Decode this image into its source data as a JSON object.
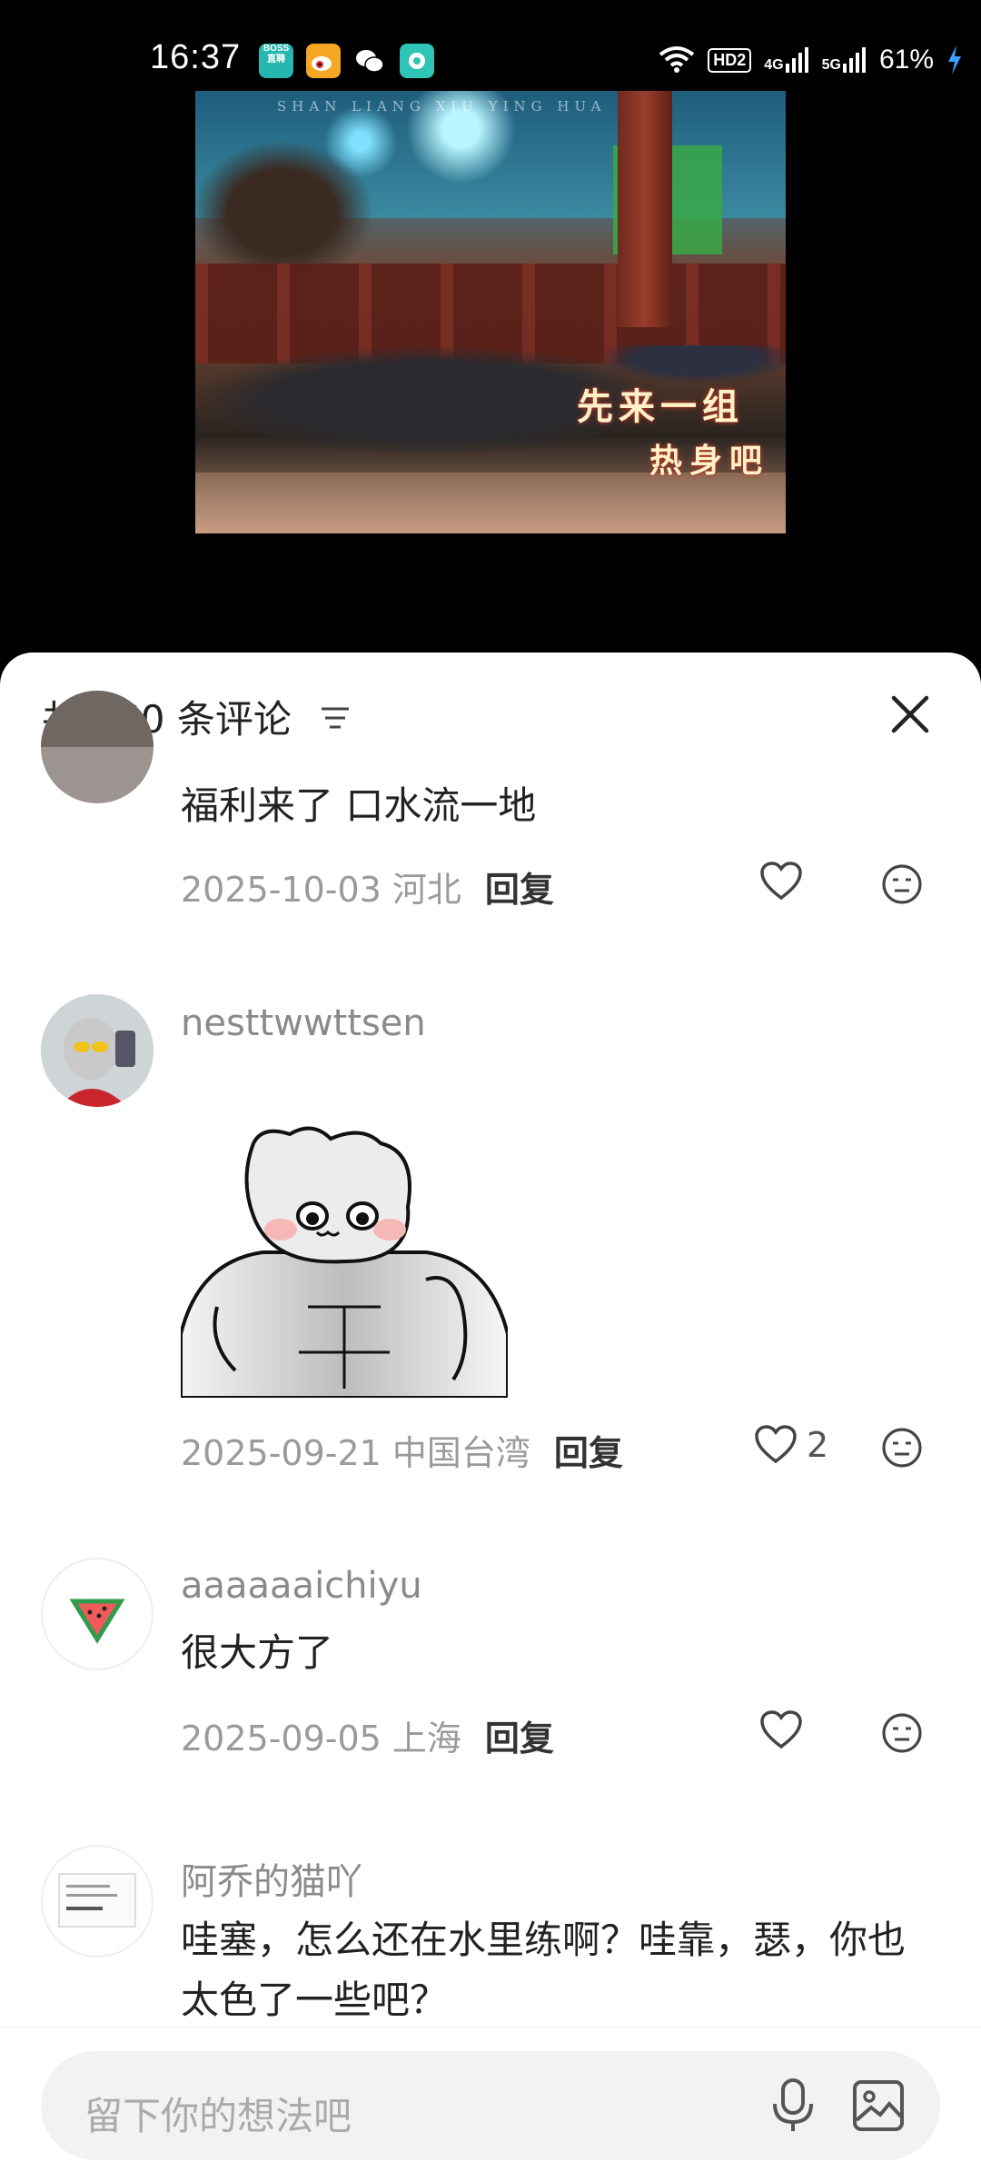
{
  "status": {
    "time": "16:37",
    "app_icons": [
      {
        "name": "boss-zhipin-icon",
        "label": "BOSS 直聘",
        "color": "#25b7b0"
      },
      {
        "name": "weibo-icon",
        "label": "",
        "color": "#f5a623"
      },
      {
        "name": "wechat-icon",
        "label": "",
        "color": "#ffffff"
      },
      {
        "name": "chat-bubble-app-icon",
        "label": "",
        "color": "#2ec4b6"
      }
    ],
    "hd": "HD2",
    "net1": "4G",
    "net2": "5G",
    "battery": "61%"
  },
  "video": {
    "watermark": "SHAN LIANG XIU YING HUA",
    "caption_line1": "先来一组",
    "caption_line2": "热身吧"
  },
  "sheet": {
    "title": "共 160 条评论"
  },
  "comments": [
    {
      "username": "",
      "text": "福利来了 口水流一地",
      "date_location": "2025-10-03 河北",
      "reply_label": "回复",
      "likes": ""
    },
    {
      "username": "nesttwwttsen",
      "text": "",
      "has_sticker": true,
      "date_location": "2025-09-21 中国台湾",
      "reply_label": "回复",
      "likes": "2"
    },
    {
      "username": "aaaaaaichiyu",
      "text": "很大方了",
      "date_location": "2025-09-05 上海",
      "reply_label": "回复",
      "likes": ""
    },
    {
      "username": "阿乔的猫吖",
      "text": "哇塞，怎么还在水里练啊？哇靠，瑟，你也太色了一些吧？",
      "date_location": "",
      "reply_label": "",
      "likes": ""
    }
  ],
  "input": {
    "placeholder": "留下你的想法吧"
  },
  "colors": {
    "sheet_bg": "#ffffff",
    "meta_text": "#9a9a9a",
    "charging": "#3aa0ff"
  }
}
